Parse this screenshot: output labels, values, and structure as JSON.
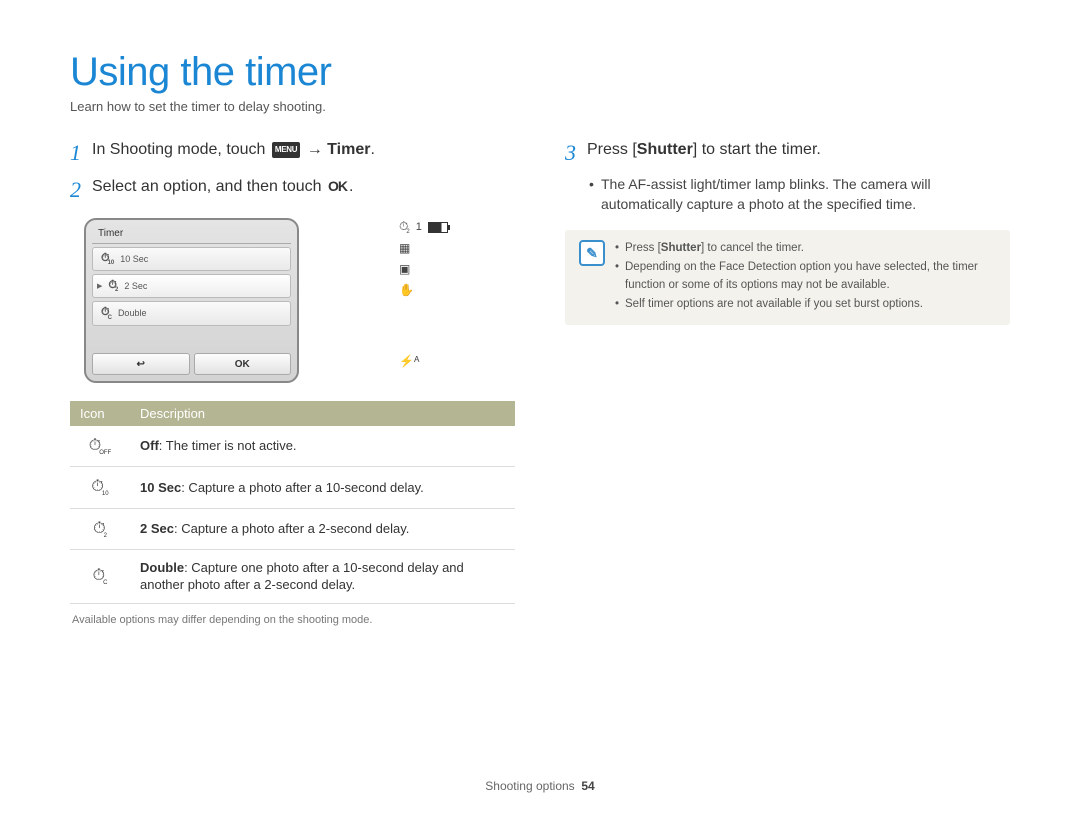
{
  "title": "Using the timer",
  "subtitle": "Learn how to set the timer to delay shooting.",
  "steps_left": [
    {
      "num": "1",
      "pre": "In Shooting mode, touch ",
      "chip": "MENU",
      "arrow": " → ",
      "boldTail": "Timer",
      "post": "."
    },
    {
      "num": "2",
      "pre": "Select an option, and then touch ",
      "ok": "OK",
      "post": "."
    }
  ],
  "lcd": {
    "title": "Timer",
    "rows": [
      {
        "icon": "⏱",
        "sub": "10",
        "label": "10 Sec",
        "selected": false
      },
      {
        "icon": "⏱",
        "sub": "2",
        "label": "2 Sec",
        "selected": true
      },
      {
        "icon": "⏱",
        "sub": "C",
        "label": "Double",
        "selected": false
      }
    ],
    "back": "↩",
    "ok": "OK"
  },
  "status": {
    "topIcon": "⏱",
    "topSub": "2",
    "one": "1",
    "lines": [
      "▦",
      "▣",
      "✋"
    ],
    "flash": "⚡ᴬ"
  },
  "table": {
    "headers": {
      "icon": "Icon",
      "desc": "Description"
    },
    "rows": [
      {
        "iconSub": "OFF",
        "bold": "Off",
        "rest": ": The timer is not active."
      },
      {
        "iconSub": "10",
        "bold": "10 Sec",
        "rest": ": Capture a photo after a 10-second delay."
      },
      {
        "iconSub": "2",
        "bold": "2 Sec",
        "rest": ": Capture a photo after a 2-second delay."
      },
      {
        "iconSub": "C",
        "bold": "Double",
        "rest": ": Capture one photo after a 10-second delay and another photo after a 2-second delay."
      }
    ],
    "footnote": "Available options may differ depending on the shooting mode."
  },
  "right": {
    "step": {
      "num": "3",
      "pre": "Press [",
      "bold": "Shutter",
      "post": "] to start the timer."
    },
    "bullets": [
      "The AF-assist light/timer lamp blinks. The camera will automatically capture a photo at the specified time."
    ],
    "notes_strong": "Shutter",
    "notes": [
      {
        "pre": "Press [",
        "bold": "Shutter",
        "post": "] to cancel the timer."
      },
      {
        "text": "Depending on the Face Detection option you have selected, the timer function or some of its options may not be available."
      },
      {
        "text": "Self timer options are not available if you set burst options."
      }
    ]
  },
  "footer": {
    "section": "Shooting options",
    "page": "54"
  }
}
